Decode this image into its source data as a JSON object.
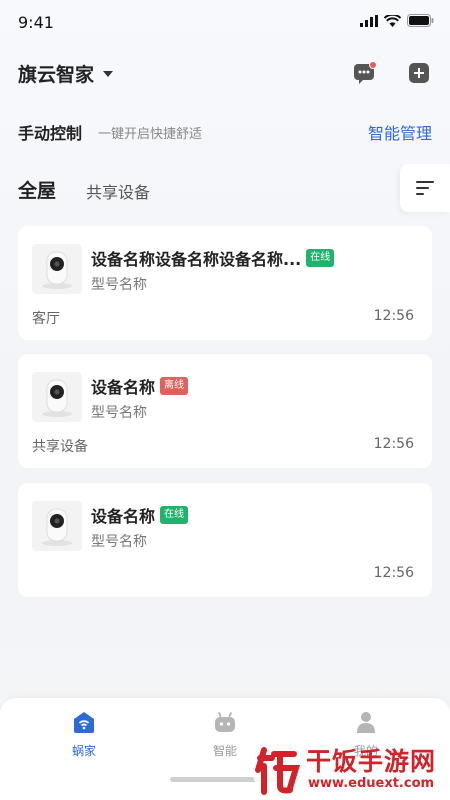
{
  "status": {
    "time": "9:41"
  },
  "header": {
    "home_name": "旗云智家"
  },
  "quick": {
    "title": "手动控制",
    "subtitle": "一键开启快捷舒适",
    "manage": "智能管理"
  },
  "tabs": {
    "active": "全屋",
    "other": "共享设备"
  },
  "devices": [
    {
      "name": "设备名称设备名称设备名称...",
      "status": "在线",
      "model": "型号名称",
      "room": "客厅",
      "time": "12:56"
    },
    {
      "name": "设备名称",
      "status": "离线",
      "model": "型号名称",
      "room": "共享设备",
      "time": "12:56"
    },
    {
      "name": "设备名称",
      "status": "在线",
      "model": "型号名称",
      "room": "",
      "time": "12:56"
    }
  ],
  "nav": [
    {
      "label": "蜗家",
      "icon": "home-wifi-icon",
      "active": true
    },
    {
      "label": "智能",
      "icon": "robot-icon",
      "active": false
    },
    {
      "label": "我的",
      "icon": "person-icon",
      "active": false
    }
  ],
  "watermark": {
    "name": "干饭手游网",
    "url": "www.eduext.com"
  },
  "colors": {
    "accent": "#2e6ad6",
    "online": "#21b36c",
    "offline": "#e0605e",
    "watermark": "#d1242a"
  }
}
